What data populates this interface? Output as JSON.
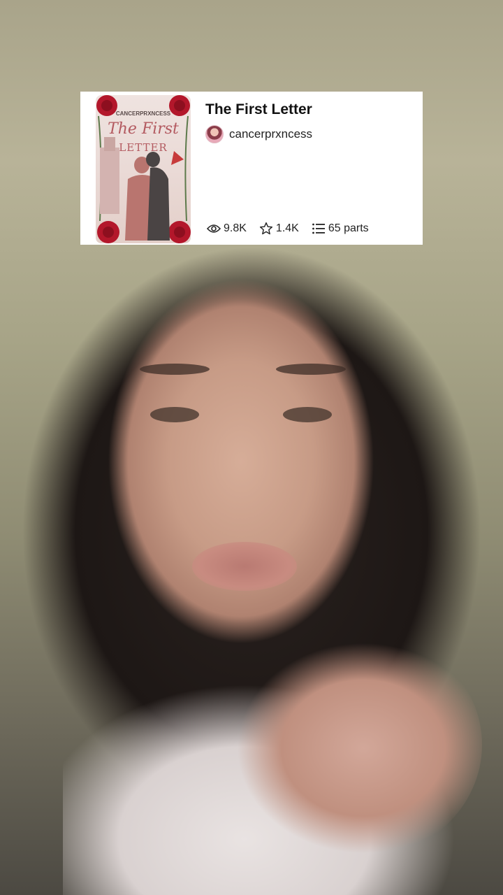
{
  "story": {
    "title": "The First Letter",
    "author": "cancerprxncess",
    "cover": {
      "author_text": "CANCERPRXNCESS",
      "title_line1": "The First",
      "title_line2": "LETTER"
    },
    "stats": {
      "views": "9.8K",
      "votes": "1.4K",
      "parts": "65 parts"
    }
  },
  "icons": {
    "views": "eye-icon",
    "votes": "star-icon",
    "parts": "list-icon"
  },
  "colors": {
    "card_background": "#ffffff",
    "text_primary": "#121212",
    "rose_red": "#b3172b"
  }
}
